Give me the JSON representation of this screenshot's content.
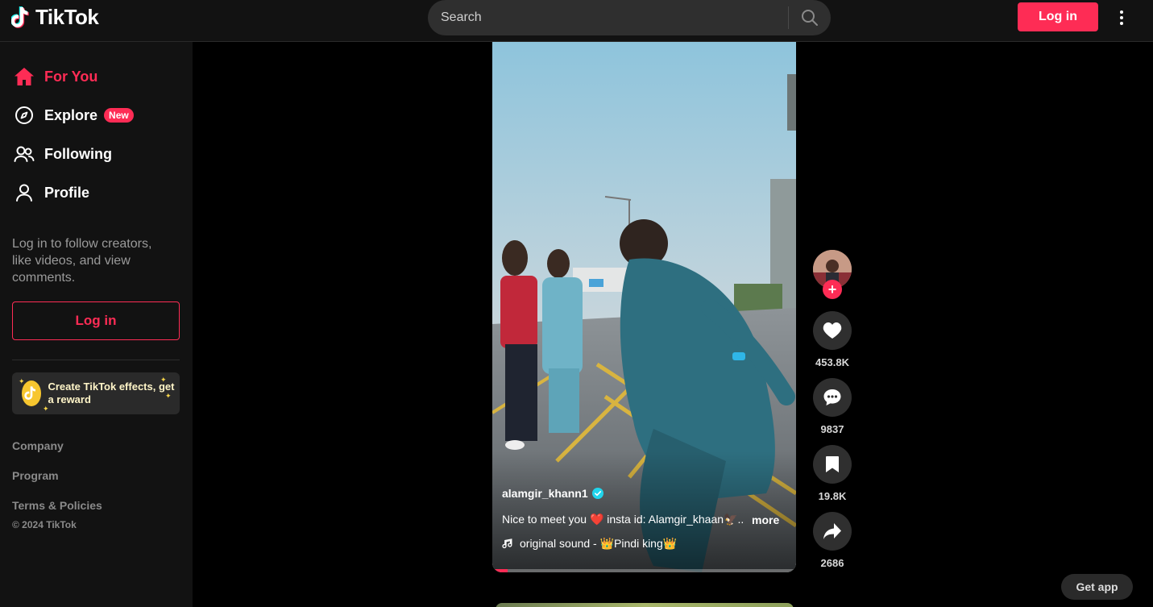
{
  "header": {
    "logo_text": "TikTok",
    "search_placeholder": "Search",
    "login_label": "Log in"
  },
  "sidebar": {
    "nav": [
      {
        "label": "For You",
        "icon": "home-icon",
        "active": true
      },
      {
        "label": "Explore",
        "icon": "compass-icon",
        "badge": "New"
      },
      {
        "label": "Following",
        "icon": "users-icon"
      },
      {
        "label": "Profile",
        "icon": "person-icon"
      }
    ],
    "message": "Log in to follow creators, like videos, and view comments.",
    "login_label": "Log in",
    "effects_card": "Create TikTok effects, get a reward",
    "footer_links": [
      "Company",
      "Program",
      "Terms & Policies"
    ],
    "copyright": "© 2024 TikTok"
  },
  "video": {
    "author": "alamgir_khann1",
    "verified": true,
    "caption": "Nice to meet you ❤️ insta id: Alamgir_khaan🦅...",
    "more_label": "more",
    "sound": "original sound - 👑Pindi king👑",
    "progress": 0.05
  },
  "actions": {
    "likes": "453.8K",
    "comments": "9837",
    "saves": "19.8K",
    "shares": "2686"
  },
  "get_app_label": "Get app",
  "colors": {
    "accent": "#fe2c55",
    "background": "#000000",
    "sidebar": "#121212",
    "verified": "#20d5ec"
  }
}
